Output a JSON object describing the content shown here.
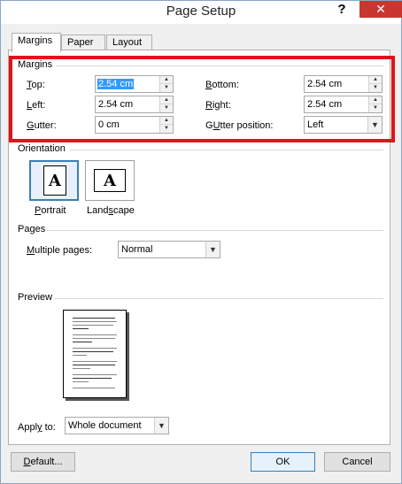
{
  "window": {
    "title": "Page Setup",
    "help": "?",
    "close": "✕"
  },
  "tabs": [
    {
      "label": "Margins",
      "active": true
    },
    {
      "label": "Paper",
      "active": false
    },
    {
      "label": "Layout",
      "active": false
    }
  ],
  "margins": {
    "group_label": "Margins",
    "top": {
      "label_ul": "T",
      "label_rest": "op:",
      "value": "2.54 cm"
    },
    "bottom": {
      "label_ul": "B",
      "label_rest": "ottom:",
      "value": "2.54 cm"
    },
    "left": {
      "label_ul": "L",
      "label_rest": "eft:",
      "value": "2.54 cm"
    },
    "right": {
      "label_ul": "R",
      "label_rest": "ight:",
      "value": "2.54 cm"
    },
    "gutter": {
      "label_ul": "G",
      "label_rest": "utter:",
      "value": "0 cm"
    },
    "gutter_position": {
      "label_ul": "U",
      "label_pre": "G",
      "label_rest": "tter position:",
      "value": "Left"
    }
  },
  "orientation": {
    "group_label": "Orientation",
    "portrait": {
      "label_ul": "P",
      "label_rest": "ortrait",
      "icon_letter": "A"
    },
    "landscape": {
      "label_pre": "Land",
      "label_ul": "s",
      "label_rest": "cape",
      "icon_letter": "A"
    }
  },
  "pages": {
    "group_label": "Pages",
    "multiple_label_ul": "M",
    "multiple_label_rest": "ultiple pages:",
    "multiple_value": "Normal"
  },
  "preview": {
    "group_label": "Preview"
  },
  "apply_to": {
    "label_pre": "Appl",
    "label_ul": "y",
    "label_rest": " to:",
    "value": "Whole document"
  },
  "buttons": {
    "default_ul": "D",
    "default_rest": "efault...",
    "ok": "OK",
    "cancel": "Cancel"
  },
  "colors": {
    "highlight": "#e0131b",
    "close_bg": "#c7372e",
    "selection": "#3399ff"
  }
}
